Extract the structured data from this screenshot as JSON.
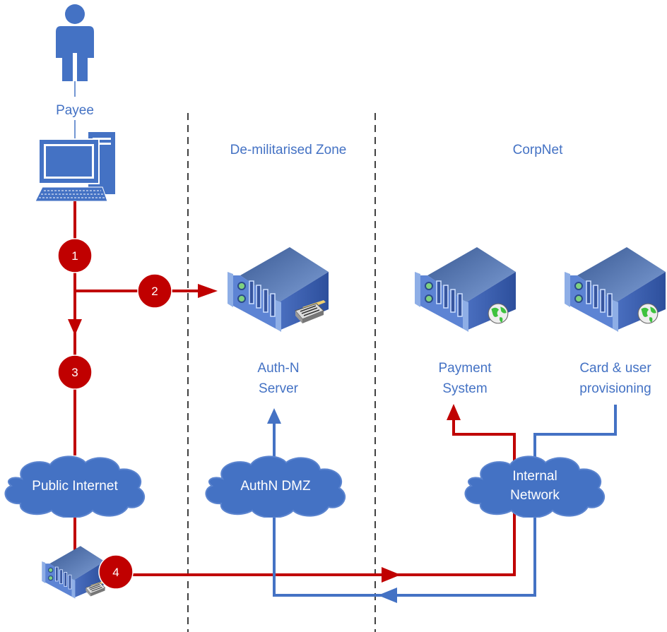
{
  "zones": {
    "dmz": "De-militarised Zone",
    "corpnet": "CorpNet"
  },
  "actor": {
    "label": "Payee"
  },
  "servers": {
    "authn": {
      "line1": "Auth-N",
      "line2": "Server"
    },
    "payment": {
      "line1": "Payment",
      "line2": "System"
    },
    "provisioning": {
      "line1": "Card & user",
      "line2": "provisioning"
    }
  },
  "clouds": {
    "public": {
      "line1": "Public Internet"
    },
    "dmz": {
      "line1": "AuthN DMZ"
    },
    "internal": {
      "line1": "Internal",
      "line2": "Network"
    }
  },
  "steps": [
    "1",
    "2",
    "3",
    "4"
  ],
  "colors": {
    "text": "#4472C4",
    "red_flow": "#C00000",
    "blue_flow": "#4472C4",
    "cloud": "#4472C4",
    "step_badge": "#C00000"
  }
}
